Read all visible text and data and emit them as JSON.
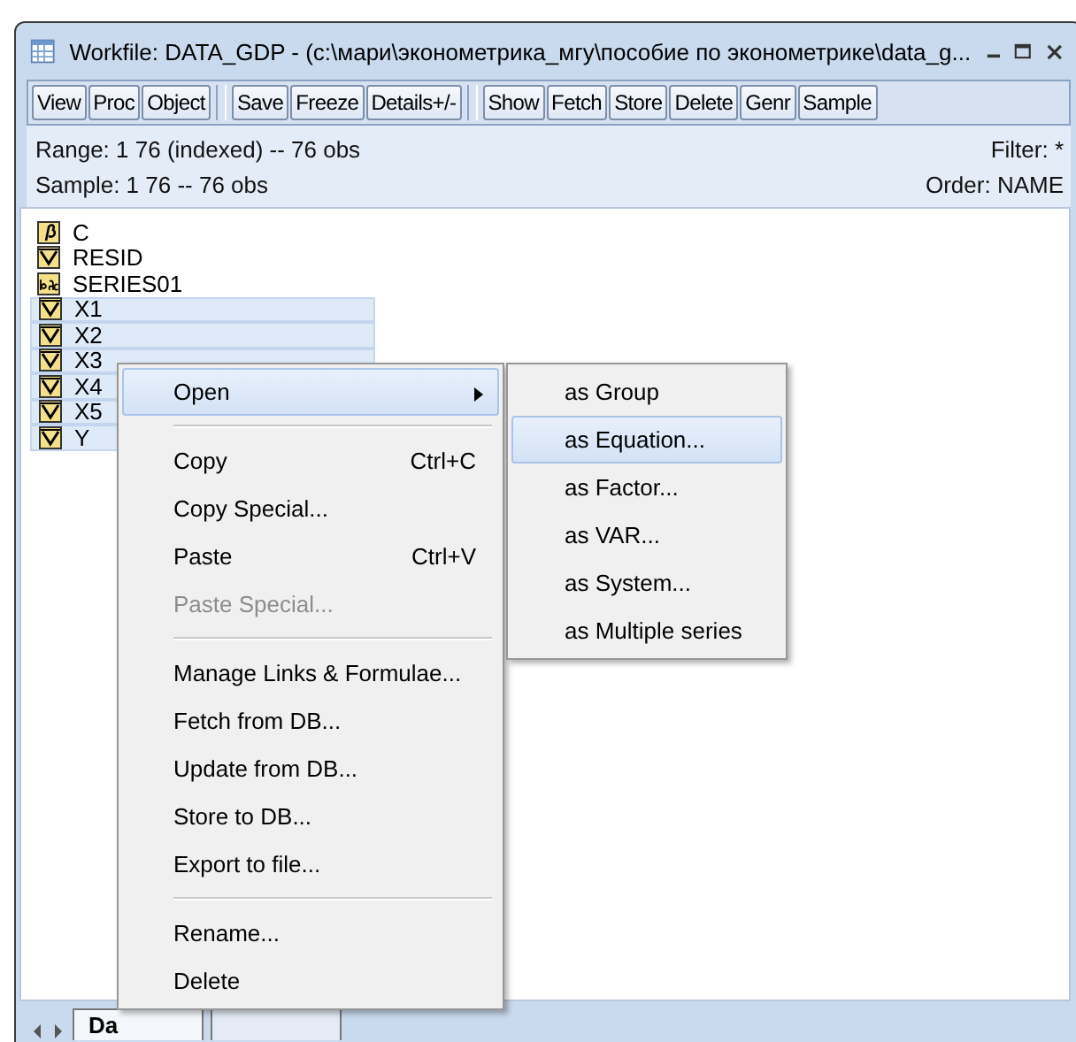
{
  "window": {
    "title": "Workfile: DATA_GDP - (c:\\мари\\эконометрика_мгу\\пособие по эконометрике\\data_g..."
  },
  "toolbar": [
    [
      "View",
      "Proc",
      "Object"
    ],
    [
      "Save",
      "Freeze",
      "Details+/-"
    ],
    [
      "Show",
      "Fetch",
      "Store",
      "Delete",
      "Genr",
      "Sample"
    ]
  ],
  "info": {
    "range": "Range:  1 76 (indexed)  --  76 obs",
    "sample": "Sample: 1 76  --  76 obs",
    "filter": "Filter: *",
    "order": "Order: NAME"
  },
  "objects": [
    {
      "name": "C",
      "kind": "coef",
      "selected": false
    },
    {
      "name": "RESID",
      "kind": "series",
      "selected": false
    },
    {
      "name": "SERIES01",
      "kind": "alpha",
      "selected": false
    },
    {
      "name": "X1",
      "kind": "series",
      "selected": true
    },
    {
      "name": "X2",
      "kind": "series",
      "selected": true
    },
    {
      "name": "X3",
      "kind": "series",
      "selected": true
    },
    {
      "name": "X4",
      "kind": "series",
      "selected": true
    },
    {
      "name": "X5",
      "kind": "series",
      "selected": true
    },
    {
      "name": "Y",
      "kind": "series",
      "selected": true
    }
  ],
  "context_menu": [
    {
      "kind": "item",
      "label": "Open",
      "submenu": true,
      "selected": true,
      "disabled": false
    },
    {
      "kind": "separator"
    },
    {
      "kind": "item",
      "label": "Copy",
      "shortcut": "Ctrl+C",
      "selected": false,
      "disabled": false
    },
    {
      "kind": "item",
      "label": "Copy Special...",
      "selected": false,
      "disabled": false
    },
    {
      "kind": "item",
      "label": "Paste",
      "shortcut": "Ctrl+V",
      "selected": false,
      "disabled": false
    },
    {
      "kind": "item",
      "label": "Paste Special...",
      "selected": false,
      "disabled": true
    },
    {
      "kind": "separator"
    },
    {
      "kind": "item",
      "label": "Manage Links & Formulae...",
      "selected": false,
      "disabled": false
    },
    {
      "kind": "item",
      "label": "Fetch from DB...",
      "selected": false,
      "disabled": false
    },
    {
      "kind": "item",
      "label": "Update from DB...",
      "selected": false,
      "disabled": false
    },
    {
      "kind": "item",
      "label": "Store to DB...",
      "selected": false,
      "disabled": false
    },
    {
      "kind": "item",
      "label": "Export to file...",
      "selected": false,
      "disabled": false
    },
    {
      "kind": "separator"
    },
    {
      "kind": "item",
      "label": "Rename...",
      "selected": false,
      "disabled": false
    },
    {
      "kind": "item",
      "label": "Delete",
      "selected": false,
      "disabled": false
    }
  ],
  "submenu": [
    {
      "label": "as Group",
      "selected": false
    },
    {
      "label": "as Equation...",
      "selected": true
    },
    {
      "label": "as Factor...",
      "selected": false
    },
    {
      "label": "as VAR...",
      "selected": false
    },
    {
      "label": "as System...",
      "selected": false
    },
    {
      "label": "as Multiple series",
      "selected": false
    }
  ],
  "page_tabs": [
    {
      "label": "Da",
      "selected": true
    },
    {
      "selected": false
    }
  ]
}
